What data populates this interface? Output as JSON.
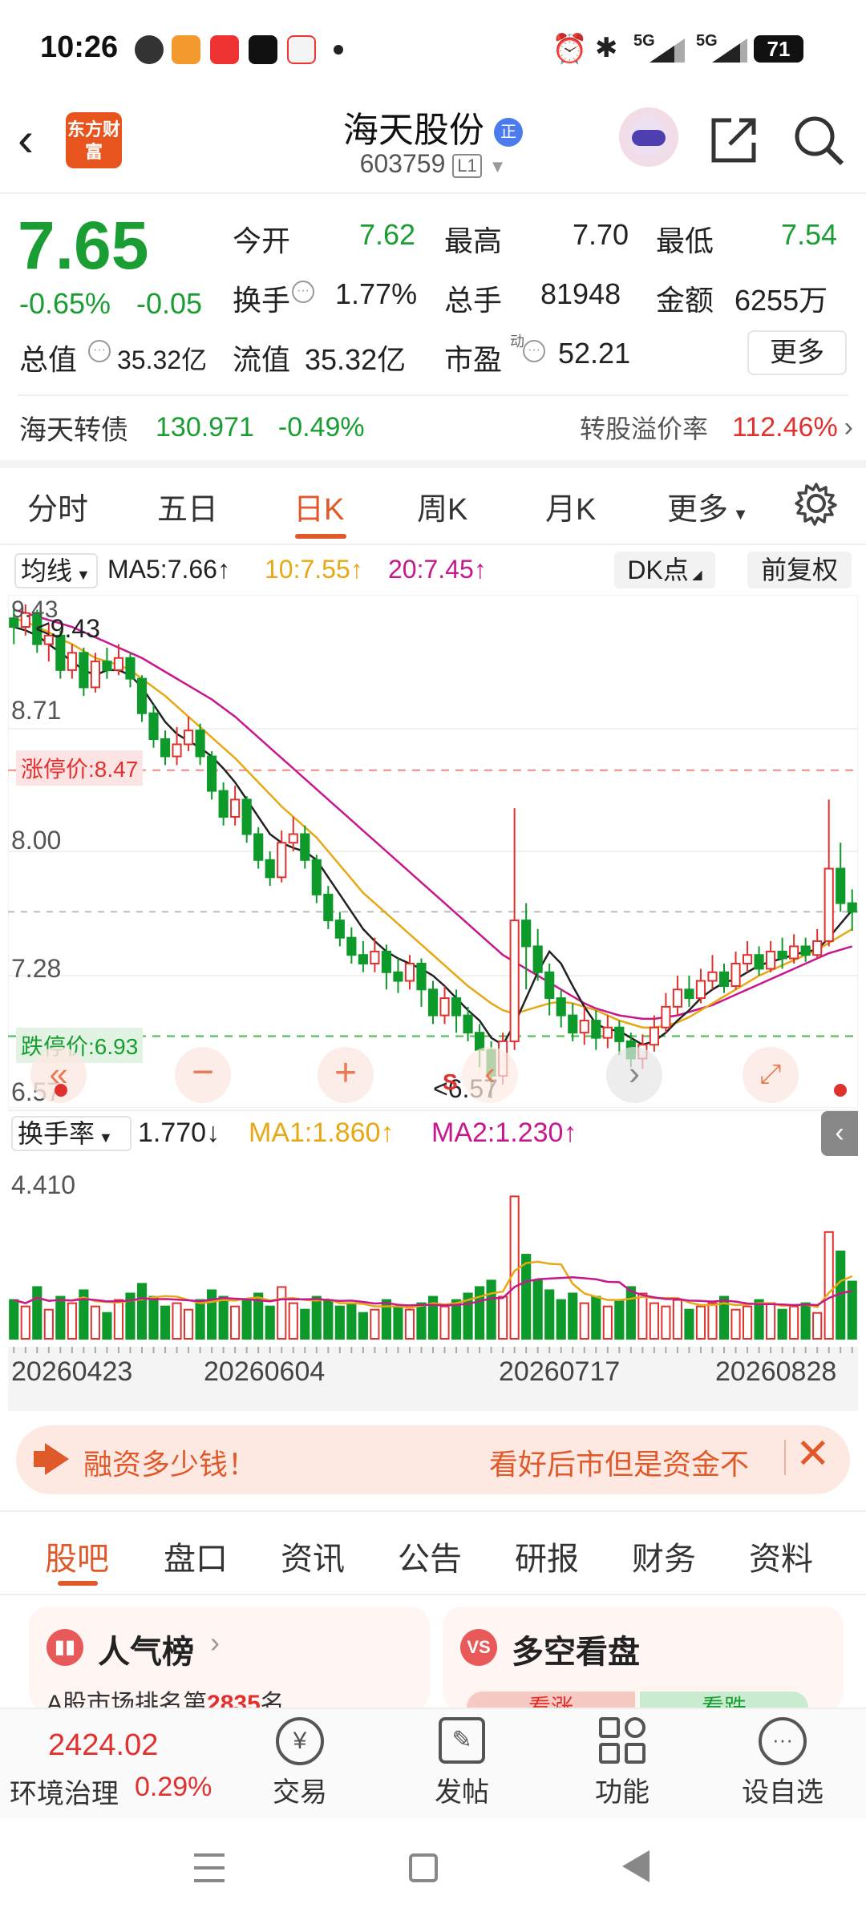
{
  "status_bar": {
    "time": "10:26",
    "net1": "5G",
    "net2": "5G",
    "battery": "71"
  },
  "header": {
    "name": "海天股份",
    "badge": "正",
    "code": "603759",
    "board": "L1",
    "logo_text": "东方财富"
  },
  "quote": {
    "price": "7.65",
    "change_pct": "-0.65%",
    "change": "-0.05",
    "rows": [
      [
        {
          "label": "今开",
          "value": "7.62",
          "tone": "green"
        },
        {
          "label": "最高",
          "value": "7.70",
          "tone": "dark"
        },
        {
          "label": "最低",
          "value": "7.54",
          "tone": "green"
        }
      ],
      [
        {
          "label": "换手",
          "value": "1.77%",
          "tone": "dark"
        },
        {
          "label": "总手",
          "value": "81948",
          "tone": "dark"
        },
        {
          "label": "金额",
          "value": "6255万",
          "tone": "dark"
        }
      ],
      [
        {
          "label": "流值",
          "value": "35.32亿",
          "tone": "dark"
        },
        {
          "label": "市盈",
          "value": "52.21",
          "tone": "dark"
        }
      ]
    ],
    "total_value_label": "总值",
    "total_value": "35.32亿",
    "pe_sup": "动",
    "more_btn": "更多"
  },
  "convertible": {
    "name": "海天转债",
    "price": "130.971",
    "change": "-0.49%",
    "premium_label": "转股溢价率",
    "premium": "112.46%"
  },
  "chart_tabs": [
    "分时",
    "五日",
    "日K",
    "周K",
    "月K",
    "更多"
  ],
  "active_tab": 2,
  "kline": {
    "ma_select": "均线",
    "ma5": "MA5:7.66↑",
    "ma10": "10:7.55↑",
    "ma20": "20:7.45↑",
    "dk_btn": "DK点",
    "adjust_btn": "前复权",
    "axis": [
      "9.43",
      "8.71",
      "8.00",
      "7.28",
      "6.57"
    ],
    "limit_up": "涨停价:8.47",
    "limit_down": "跌停价:6.93",
    "high_mark": "<9.43",
    "low_mark": "<6.57",
    "s_mark": "S",
    "turnover_select": "换手率",
    "turnover_val": "1.770↓",
    "tma1": "MA1:1.860↑",
    "tma2": "MA2:1.230↑",
    "vol_axis_top": "4.410",
    "dates": [
      "20260423",
      "20260604",
      "20260717",
      "20260828"
    ]
  },
  "chart_data": {
    "type": "candlestick",
    "ylim": [
      6.57,
      9.43
    ],
    "candles": [
      [
        9.35,
        9.3,
        9.42,
        9.2
      ],
      [
        9.3,
        9.38,
        9.43,
        9.25
      ],
      [
        9.38,
        9.2,
        9.4,
        9.15
      ],
      [
        9.2,
        9.25,
        9.32,
        9.1
      ],
      [
        9.25,
        9.05,
        9.28,
        9.0
      ],
      [
        9.05,
        9.15,
        9.2,
        9.0
      ],
      [
        9.15,
        8.95,
        9.18,
        8.9
      ],
      [
        8.95,
        9.1,
        9.15,
        8.92
      ],
      [
        9.1,
        9.05,
        9.18,
        9.0
      ],
      [
        9.05,
        9.12,
        9.2,
        9.02
      ],
      [
        9.12,
        9.0,
        9.15,
        8.95
      ],
      [
        9.0,
        8.8,
        9.02,
        8.75
      ],
      [
        8.8,
        8.65,
        8.85,
        8.6
      ],
      [
        8.65,
        8.55,
        8.7,
        8.5
      ],
      [
        8.55,
        8.62,
        8.72,
        8.5
      ],
      [
        8.62,
        8.7,
        8.78,
        8.58
      ],
      [
        8.7,
        8.55,
        8.74,
        8.5
      ],
      [
        8.55,
        8.35,
        8.58,
        8.3
      ],
      [
        8.35,
        8.2,
        8.4,
        8.15
      ],
      [
        8.2,
        8.3,
        8.38,
        8.15
      ],
      [
        8.3,
        8.1,
        8.32,
        8.05
      ],
      [
        8.1,
        7.95,
        8.14,
        7.9
      ],
      [
        7.95,
        7.85,
        8.0,
        7.8
      ],
      [
        7.85,
        8.05,
        8.12,
        7.82
      ],
      [
        8.05,
        8.1,
        8.2,
        8.0
      ],
      [
        8.1,
        7.95,
        8.15,
        7.9
      ],
      [
        7.95,
        7.75,
        7.98,
        7.7
      ],
      [
        7.75,
        7.6,
        7.8,
        7.55
      ],
      [
        7.6,
        7.5,
        7.65,
        7.45
      ],
      [
        7.5,
        7.4,
        7.56,
        7.35
      ],
      [
        7.4,
        7.35,
        7.48,
        7.3
      ],
      [
        7.35,
        7.42,
        7.5,
        7.3
      ],
      [
        7.42,
        7.3,
        7.46,
        7.2
      ],
      [
        7.3,
        7.25,
        7.38,
        7.18
      ],
      [
        7.25,
        7.35,
        7.4,
        7.2
      ],
      [
        7.35,
        7.2,
        7.38,
        7.1
      ],
      [
        7.2,
        7.05,
        7.25,
        7.0
      ],
      [
        7.05,
        7.15,
        7.22,
        7.0
      ],
      [
        7.15,
        7.05,
        7.2,
        6.95
      ],
      [
        7.05,
        6.95,
        7.1,
        6.9
      ],
      [
        6.95,
        6.85,
        7.0,
        6.75
      ],
      [
        6.85,
        6.7,
        6.9,
        6.57
      ],
      [
        6.7,
        6.9,
        6.95,
        6.65
      ],
      [
        6.9,
        7.6,
        8.25,
        6.85
      ],
      [
        7.6,
        7.45,
        7.7,
        7.2
      ],
      [
        7.45,
        7.3,
        7.55,
        7.25
      ],
      [
        7.3,
        7.15,
        7.35,
        7.05
      ],
      [
        7.15,
        7.05,
        7.2,
        6.98
      ],
      [
        7.05,
        6.95,
        7.12,
        6.9
      ],
      [
        6.95,
        7.02,
        7.1,
        6.88
      ],
      [
        7.02,
        6.92,
        7.08,
        6.85
      ],
      [
        6.92,
        6.98,
        7.05,
        6.86
      ],
      [
        6.98,
        6.9,
        7.02,
        6.82
      ],
      [
        6.9,
        6.8,
        6.95,
        6.75
      ],
      [
        6.8,
        6.88,
        6.94,
        6.74
      ],
      [
        6.88,
        6.98,
        7.05,
        6.84
      ],
      [
        6.98,
        7.1,
        7.18,
        6.95
      ],
      [
        7.1,
        7.2,
        7.28,
        7.05
      ],
      [
        7.2,
        7.15,
        7.28,
        7.1
      ],
      [
        7.15,
        7.25,
        7.32,
        7.12
      ],
      [
        7.25,
        7.3,
        7.4,
        7.2
      ],
      [
        7.3,
        7.22,
        7.35,
        7.18
      ],
      [
        7.22,
        7.35,
        7.42,
        7.2
      ],
      [
        7.35,
        7.4,
        7.48,
        7.3
      ],
      [
        7.4,
        7.32,
        7.45,
        7.28
      ],
      [
        7.32,
        7.42,
        7.48,
        7.3
      ],
      [
        7.42,
        7.38,
        7.5,
        7.32
      ],
      [
        7.38,
        7.45,
        7.52,
        7.35
      ],
      [
        7.45,
        7.4,
        7.5,
        7.36
      ],
      [
        7.4,
        7.48,
        7.55,
        7.38
      ],
      [
        7.48,
        7.9,
        8.3,
        7.45
      ],
      [
        7.9,
        7.7,
        8.05,
        7.65
      ],
      [
        7.7,
        7.65,
        7.78,
        7.54
      ]
    ],
    "ma5": [
      9.3,
      9.28,
      9.25,
      9.2,
      9.15,
      9.1,
      9.05,
      9.02,
      9.05,
      9.05,
      9.02,
      8.95,
      8.85,
      8.75,
      8.68,
      8.64,
      8.6,
      8.55,
      8.48,
      8.4,
      8.3,
      8.2,
      8.1,
      8.05,
      8.02,
      8.0,
      7.95,
      7.85,
      7.75,
      7.65,
      7.55,
      7.48,
      7.42,
      7.38,
      7.35,
      7.32,
      7.28,
      7.22,
      7.15,
      7.08,
      7.02,
      6.92,
      6.88,
      7.0,
      7.15,
      7.3,
      7.42,
      7.35,
      7.22,
      7.1,
      7.0,
      6.97,
      6.96,
      6.92,
      6.88,
      6.9,
      6.95,
      7.02,
      7.08,
      7.15,
      7.2,
      7.24,
      7.26,
      7.3,
      7.34,
      7.36,
      7.38,
      7.4,
      7.42,
      7.43,
      7.5,
      7.58,
      7.66
    ],
    "ma10": [
      9.35,
      9.33,
      9.3,
      9.27,
      9.23,
      9.2,
      9.16,
      9.12,
      9.1,
      9.08,
      9.05,
      9.0,
      8.95,
      8.9,
      8.84,
      8.78,
      8.72,
      8.66,
      8.6,
      8.54,
      8.47,
      8.4,
      8.33,
      8.26,
      8.2,
      8.14,
      8.08,
      8.0,
      7.92,
      7.84,
      7.76,
      7.7,
      7.64,
      7.58,
      7.52,
      7.46,
      7.4,
      7.34,
      7.28,
      7.22,
      7.17,
      7.12,
      7.08,
      7.06,
      7.08,
      7.1,
      7.12,
      7.13,
      7.12,
      7.1,
      7.08,
      7.05,
      7.02,
      7.0,
      6.98,
      6.98,
      6.99,
      7.01,
      7.04,
      7.08,
      7.12,
      7.16,
      7.2,
      7.24,
      7.28,
      7.31,
      7.34,
      7.37,
      7.4,
      7.43,
      7.47,
      7.51,
      7.55
    ],
    "ma20": [
      9.4,
      9.38,
      9.36,
      9.34,
      9.32,
      9.3,
      9.27,
      9.24,
      9.21,
      9.18,
      9.15,
      9.12,
      9.08,
      9.04,
      9.0,
      8.96,
      8.92,
      8.88,
      8.83,
      8.78,
      8.72,
      8.66,
      8.6,
      8.54,
      8.48,
      8.42,
      8.36,
      8.3,
      8.24,
      8.18,
      8.12,
      8.06,
      8.0,
      7.94,
      7.88,
      7.82,
      7.76,
      7.7,
      7.64,
      7.58,
      7.52,
      7.46,
      7.4,
      7.36,
      7.32,
      7.28,
      7.24,
      7.2,
      7.16,
      7.12,
      7.09,
      7.07,
      7.05,
      7.04,
      7.03,
      7.03,
      7.04,
      7.05,
      7.07,
      7.09,
      7.11,
      7.14,
      7.17,
      7.2,
      7.23,
      7.26,
      7.29,
      7.32,
      7.35,
      7.38,
      7.41,
      7.43,
      7.45
    ],
    "volume": [
      1.2,
      1.0,
      1.6,
      0.9,
      1.3,
      1.1,
      1.5,
      1.0,
      0.8,
      1.2,
      1.4,
      1.7,
      1.3,
      1.0,
      1.1,
      0.9,
      1.2,
      1.5,
      1.3,
      1.0,
      1.2,
      1.4,
      1.0,
      1.6,
      1.1,
      0.9,
      1.3,
      1.2,
      1.0,
      1.1,
      0.8,
      0.9,
      1.2,
      1.0,
      0.9,
      1.1,
      1.3,
      1.0,
      1.2,
      1.4,
      1.6,
      1.8,
      1.3,
      4.4,
      2.6,
      1.8,
      1.5,
      1.2,
      1.4,
      1.1,
      1.3,
      1.0,
      1.2,
      1.6,
      1.4,
      1.1,
      1.0,
      1.2,
      0.9,
      1.0,
      1.1,
      1.3,
      0.9,
      1.0,
      1.2,
      1.1,
      0.9,
      1.0,
      1.1,
      0.8,
      3.3,
      2.7,
      1.77
    ]
  },
  "banner": {
    "left_text": "融资多少钱！",
    "right_text": "看好后市但是资金不"
  },
  "bottom_tabs": [
    "股吧",
    "盘口",
    "资讯",
    "公告",
    "研报",
    "财务",
    "资料"
  ],
  "cards": {
    "rank_title": "人气榜",
    "rank_sub_prefix": "A股市场排名第",
    "rank_num": "2835",
    "rank_sub_suffix": "名",
    "vs_title": "多空看盘",
    "bull": "看涨",
    "bear": "看跌"
  },
  "bottom_nav": {
    "index_value": "2424.02",
    "index_name": "环境治理",
    "index_change": "0.29%",
    "items": [
      "交易",
      "发帖",
      "功能",
      "设自选"
    ]
  }
}
